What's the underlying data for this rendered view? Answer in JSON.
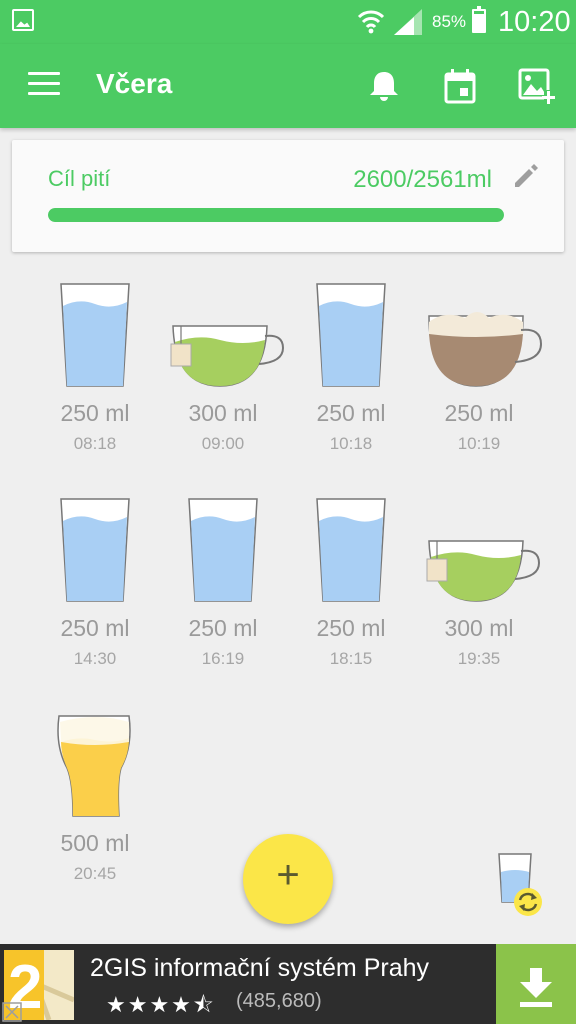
{
  "status": {
    "battery": "85%",
    "time": "10:20",
    "icons": [
      "gallery-icon",
      "wifi-icon",
      "signal-icon",
      "battery-icon"
    ]
  },
  "appbar": {
    "title": "Včera",
    "icons": [
      "menu-icon",
      "bell-icon",
      "calendar-icon",
      "add-photo-icon"
    ]
  },
  "goal": {
    "label": "Cíl pití",
    "amount": "2600/2561ml",
    "progress": 1.0
  },
  "entries": [
    {
      "amount": "250 ml",
      "time": "08:18",
      "drink": "water"
    },
    {
      "amount": "300 ml",
      "time": "09:00",
      "drink": "green-tea"
    },
    {
      "amount": "250 ml",
      "time": "10:18",
      "drink": "water"
    },
    {
      "amount": "250 ml",
      "time": "10:19",
      "drink": "cappuccino"
    },
    {
      "amount": "250 ml",
      "time": "14:30",
      "drink": "water"
    },
    {
      "amount": "250 ml",
      "time": "16:19",
      "drink": "water"
    },
    {
      "amount": "250 ml",
      "time": "18:15",
      "drink": "water"
    },
    {
      "amount": "300 ml",
      "time": "19:35",
      "drink": "green-tea"
    },
    {
      "amount": "500 ml",
      "time": "20:45",
      "drink": "beer"
    }
  ],
  "fab": {
    "label": "+"
  },
  "ad": {
    "logo_text": "2",
    "name": "2GIS informační systém Prahy",
    "stars": "★★★★⯪",
    "reviews": "(485,680)"
  },
  "colors": {
    "accent": "#4ccb63",
    "fab": "#fbe648",
    "water": "#a9cff4",
    "tea": "#a6cf5f",
    "coffee": "#a78a72",
    "beer": "#fbcf4a"
  }
}
